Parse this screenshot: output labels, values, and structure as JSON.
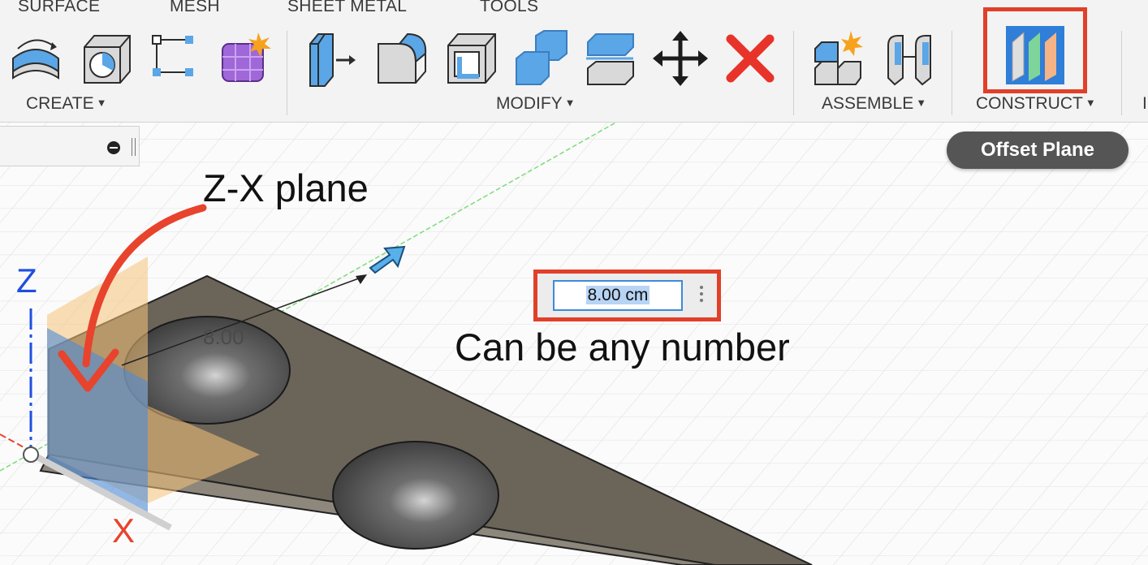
{
  "tabs": [
    "SURFACE",
    "MESH",
    "SHEET METAL",
    "TOOLS"
  ],
  "groups": {
    "create": "CREATE",
    "modify": "MODIFY",
    "assemble": "ASSEMBLE",
    "construct": "CONSTRUCT",
    "cut_off": "I"
  },
  "tools": {
    "create": [
      "extrude-icon",
      "hole-icon",
      "sketch-icon",
      "form-icon"
    ],
    "modify": [
      "press-pull-icon",
      "fillet-icon",
      "shell-icon",
      "combine-icon",
      "offset-face-icon",
      "move-icon",
      "delete-icon"
    ],
    "assemble": [
      "new-component-icon",
      "joint-icon"
    ],
    "construct": [
      "offset-plane-icon"
    ]
  },
  "tooltip": "Offset Plane",
  "annotations": {
    "zx_plane": "Z-X plane",
    "any_number": "Can be any number"
  },
  "dimension_input": {
    "value": "8.00 cm"
  },
  "dimension_ghost": "8.00",
  "axes": {
    "z": "Z",
    "x": "X"
  },
  "colors": {
    "highlight": "#e0402a",
    "axis_z": "#1f4fe0",
    "axis_x": "#e8432c",
    "plane": "#f5c27a"
  }
}
